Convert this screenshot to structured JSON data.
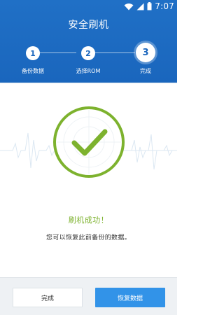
{
  "status_bar": {
    "time": "7:07",
    "icons": [
      "wifi-icon",
      "signal-icon",
      "battery-icon"
    ]
  },
  "header": {
    "title": "安全刷机",
    "steps": [
      {
        "number": "1",
        "label": "备份数据"
      },
      {
        "number": "2",
        "label": "选择ROM"
      },
      {
        "number": "3",
        "label": "完成"
      }
    ]
  },
  "main": {
    "icon": "check-circle-icon",
    "success_text": "刷机成功！",
    "description": "您可以恢复此前备份的数据。"
  },
  "footer": {
    "done_label": "完成",
    "restore_label": "恢复数据"
  },
  "colors": {
    "header_blue": "#1a66bd",
    "success_green": "#7db22e",
    "button_blue": "#3293e8"
  }
}
